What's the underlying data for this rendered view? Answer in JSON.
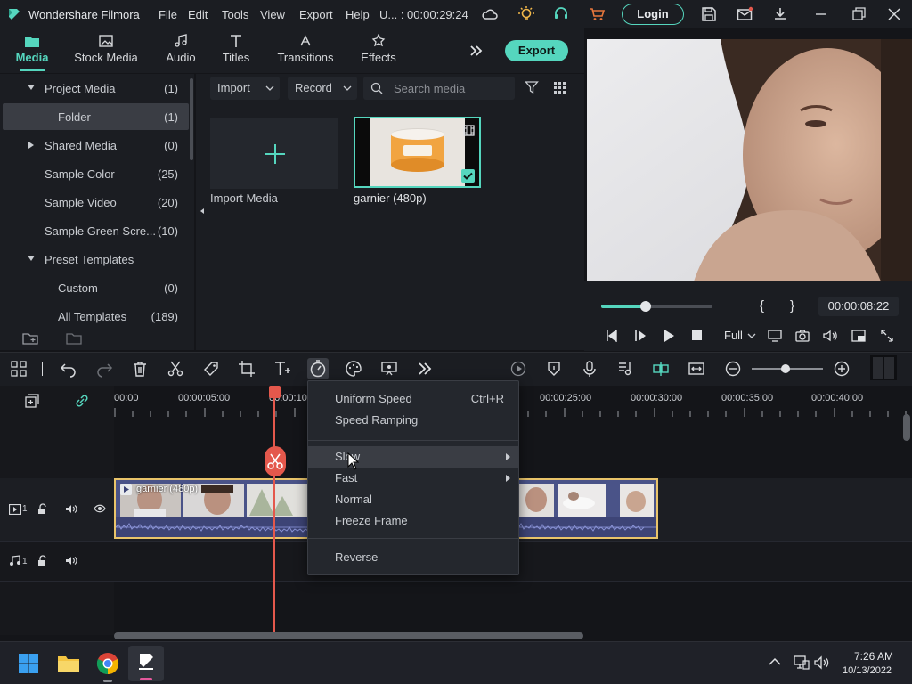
{
  "window": {
    "app_title": "Wondershare Filmora",
    "menu": [
      "File",
      "Edit",
      "Tools",
      "View",
      "Export",
      "Help"
    ],
    "project_title": "U... : 00:00:29:24",
    "login_label": "Login"
  },
  "tabs": [
    {
      "label": "Media",
      "icon": "media-folder-icon",
      "active": true
    },
    {
      "label": "Stock Media",
      "icon": "stock-media-icon"
    },
    {
      "label": "Audio",
      "icon": "music-note-icon"
    },
    {
      "label": "Titles",
      "icon": "text-t-icon"
    },
    {
      "label": "Transitions",
      "icon": "transitions-icon"
    },
    {
      "label": "Effects",
      "icon": "effects-icon"
    }
  ],
  "export_label": "Export",
  "tree": [
    {
      "label": "Project Media",
      "count": "(1)",
      "caret": "down"
    },
    {
      "label": "Folder",
      "count": "(1)",
      "selected": true
    },
    {
      "label": "Shared Media",
      "count": "(0)",
      "caret": "right"
    },
    {
      "label": "Sample Color",
      "count": "(25)"
    },
    {
      "label": "Sample Video",
      "count": "(20)"
    },
    {
      "label": "Sample Green Scre...",
      "count": "(10)"
    },
    {
      "label": "Preset Templates",
      "count": "",
      "caret": "down"
    },
    {
      "label": "Custom",
      "count": "(0)"
    },
    {
      "label": "All Templates",
      "count": "(189)"
    }
  ],
  "media_toolbar": {
    "import_label": "Import",
    "record_label": "Record",
    "search_placeholder": "Search media"
  },
  "media_items": [
    {
      "label": "Import Media"
    },
    {
      "label": "garnier (480p)"
    }
  ],
  "preview": {
    "timecode": "00:00:08:22",
    "progress": 0.2,
    "quality": "Full",
    "mark_in": "{",
    "mark_out": "}"
  },
  "timeline": {
    "ticks": [
      "00:00",
      "00:00:05:00",
      "00:00:10",
      "00:00:25:00",
      "00:00:30:00",
      "00:00:35:00",
      "00:00:40:00"
    ],
    "clip_label": "garnier (480p)",
    "video_track_num": "1",
    "audio_track_num": "1"
  },
  "context_menu": {
    "items": [
      {
        "label": "Uniform Speed",
        "shortcut": "Ctrl+R"
      },
      {
        "label": "Speed Ramping"
      },
      {
        "label": "Slow",
        "submenu": true,
        "highlighted": true
      },
      {
        "label": "Fast",
        "submenu": true
      },
      {
        "label": "Normal"
      },
      {
        "label": "Freeze Frame"
      },
      {
        "label": "Reverse"
      }
    ]
  },
  "taskbar": {
    "time": "7:26 AM",
    "date": "10/13/2022"
  },
  "colors": {
    "accent": "#55d6be",
    "playhead": "#e4584c",
    "clip_border": "#e9c46a",
    "bg": "#141519"
  }
}
